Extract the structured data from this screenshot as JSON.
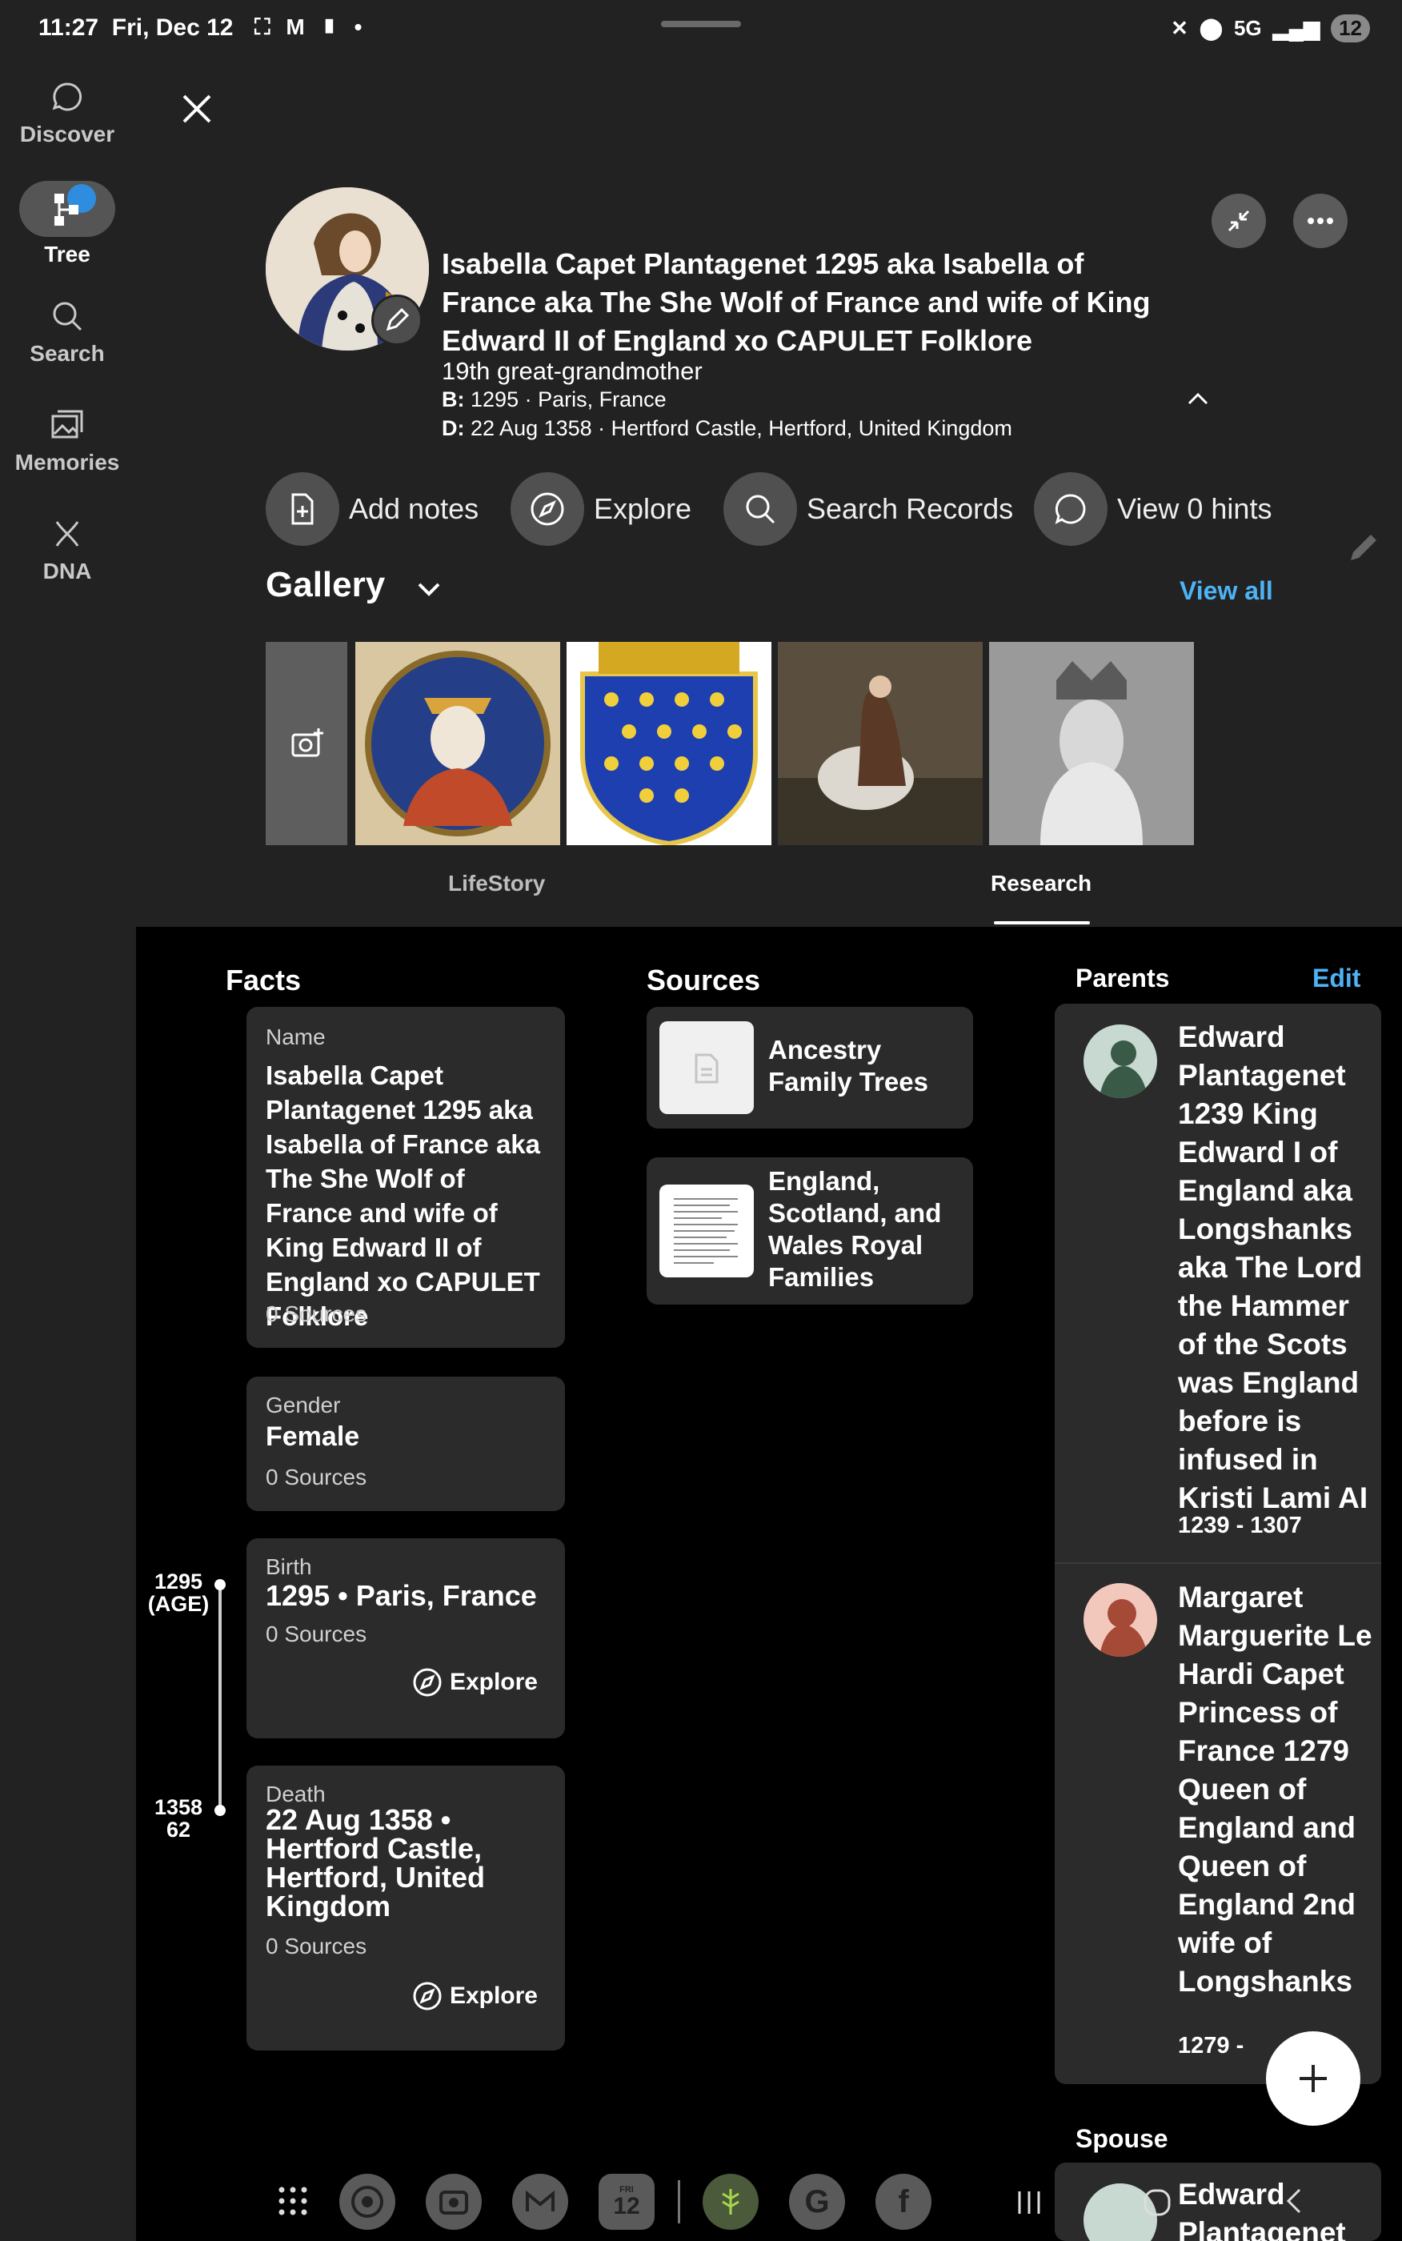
{
  "status_bar": {
    "time": "11:27",
    "date": "Fri, Dec 12",
    "left_icons": "⛶ M ▮ •",
    "right_text": "5G",
    "notif_count": "12"
  },
  "nav": {
    "items": [
      {
        "label": "Discover"
      },
      {
        "label": "Tree"
      },
      {
        "label": "Search"
      },
      {
        "label": "Memories"
      },
      {
        "label": "DNA"
      }
    ]
  },
  "person": {
    "name": "Isabella Capet Plantagenet 1295 aka Isabella of France aka The She Wolf of France and wife of King Edward II of England xo CAPULET Folklore",
    "relationship": "19th great-grandmother",
    "birth_prefix": "B:",
    "birth": "1295 · Paris, France",
    "death_prefix": "D:",
    "death": "22 Aug 1358 · Hertford Castle, Hertford, United Kingdom"
  },
  "actions": [
    {
      "label": "Add notes"
    },
    {
      "label": "Explore"
    },
    {
      "label": "Search Records"
    },
    {
      "label": "View 0 hints"
    }
  ],
  "gallery": {
    "title": "Gallery",
    "view_all": "View all"
  },
  "tabs": [
    {
      "label": "LifeStory"
    },
    {
      "label": "Research"
    }
  ],
  "facts": {
    "title": "Facts",
    "name": {
      "label": "Name",
      "value": "Isabella Capet Plantagenet 1295 aka Isabella of France aka The She Wolf of France and wife of King Edward II of England xo CAPULET Folklore",
      "sources": "0 Sources"
    },
    "gender": {
      "label": "Gender",
      "value": "Female",
      "sources": "0 Sources"
    },
    "birth": {
      "label": "Birth",
      "value": "1295 •  Paris, France",
      "sources": "0 Sources",
      "explore": "Explore"
    },
    "death": {
      "label": "Death",
      "value": "22 Aug 1358 • Hertford Castle, Hertford, United Kingdom",
      "sources": "0 Sources",
      "explore": "Explore"
    }
  },
  "timeline": {
    "birth_year": "1295",
    "birth_age": "(AGE)",
    "death_year": "1358",
    "death_age": "62"
  },
  "sources": {
    "title": "Sources",
    "items": [
      {
        "label": "Ancestry Family Trees"
      },
      {
        "label": "England, Scotland, and Wales Royal Families"
      }
    ]
  },
  "parents": {
    "title": "Parents",
    "edit": "Edit",
    "items": [
      {
        "name": "Edward Plantagenet 1239 King Edward I of England aka Longshanks aka The Lord the Hammer of the Scots was England before is infused in Kristi Lami AI",
        "years": "1239 - 1307"
      },
      {
        "name": "Margaret Marguerite Le Hardi Capet Princess of France 1279 Queen of England and Queen of England 2nd wife of Longshanks",
        "years": "1279 -"
      }
    ]
  },
  "spouse": {
    "title": "Spouse",
    "name": "Edward Plantagenet"
  },
  "dock": {
    "calendar_day": "FRI",
    "calendar_date": "12"
  },
  "colors": {
    "accent": "#4db3f5",
    "background": "#222223",
    "card": "#2b2b2b",
    "content_bg": "#000000"
  }
}
